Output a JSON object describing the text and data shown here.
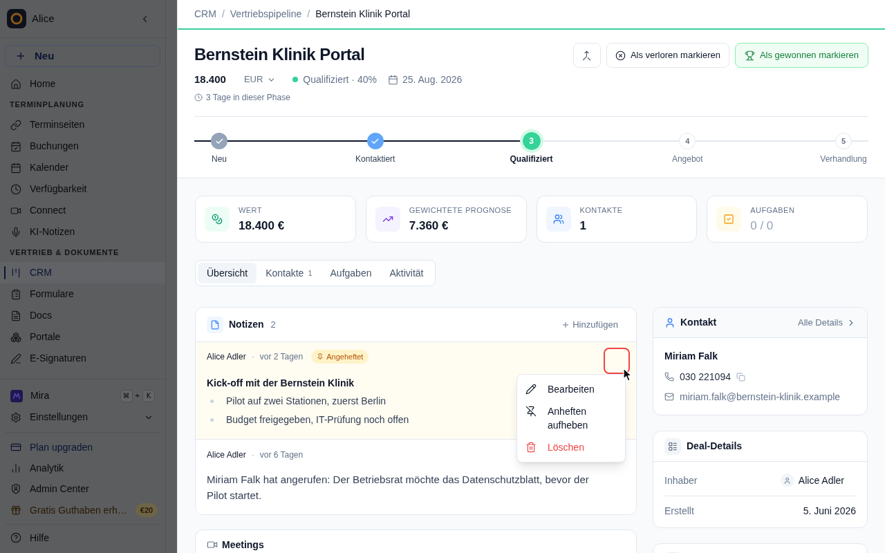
{
  "sidebar": {
    "workspace": "Alice",
    "new_button": "Neu",
    "nav": [
      {
        "kind": "item",
        "label": "Home",
        "selected": false
      },
      {
        "kind": "section",
        "label": "TERMINPLANUNG"
      },
      {
        "kind": "item",
        "label": "Terminseiten",
        "selected": false
      },
      {
        "kind": "item",
        "label": "Buchungen",
        "selected": false
      },
      {
        "kind": "item",
        "label": "Kalender",
        "selected": false
      },
      {
        "kind": "item",
        "label": "Verfügbarkeit",
        "selected": false
      },
      {
        "kind": "item",
        "label": "Connect",
        "selected": false
      },
      {
        "kind": "item",
        "label": "KI-Notizen",
        "selected": false
      },
      {
        "kind": "section",
        "label": "VERTRIEB & DOKUMENTE"
      },
      {
        "kind": "item",
        "label": "CRM",
        "selected": true
      },
      {
        "kind": "item",
        "label": "Formulare",
        "selected": false
      },
      {
        "kind": "item",
        "label": "Docs",
        "selected": false
      },
      {
        "kind": "item",
        "label": "Portale",
        "selected": false
      },
      {
        "kind": "item",
        "label": "E-Signaturen",
        "selected": false
      }
    ],
    "footer": [
      [
        {
          "kind": "assistant",
          "label": "Mira",
          "shortcut": [
            {
              "kind": "key",
              "label": "⌘"
            },
            {
              "kind": "plus",
              "label": "+"
            },
            {
              "kind": "key",
              "label": "K"
            }
          ]
        },
        {
          "kind": "expandable",
          "label": "Einstellungen",
          "expanded": false
        }
      ],
      [
        {
          "kind": "upgrade",
          "label": "Plan upgraden"
        },
        {
          "kind": "item",
          "label": "Analytik"
        },
        {
          "kind": "item",
          "label": "Admin Center"
        },
        {
          "kind": "promo",
          "label": "Gratis Guthaben erh…",
          "badge": "€20"
        }
      ],
      [
        {
          "kind": "item",
          "label": "Hilfe"
        }
      ]
    ]
  },
  "breadcrumb": [
    {
      "kind": "link",
      "label": "CRM"
    },
    {
      "kind": "separator",
      "label": "/"
    },
    {
      "kind": "link",
      "label": "Vertriebspipeline"
    },
    {
      "kind": "separator",
      "label": "/"
    },
    {
      "kind": "current",
      "label": "Bernstein Klinik Portal"
    }
  ],
  "deal": {
    "title": "Bernstein Klinik Portal",
    "amount": "18.400",
    "currency": "EUR",
    "stage": "Qualifiziert · 40%",
    "close_date": "25. Aug. 2026",
    "phase_time": "3 Tage in dieser Phase",
    "actions": [
      {
        "kind": "lost",
        "label": "Als verloren markieren"
      },
      {
        "kind": "won",
        "label": "Als gewonnen markieren"
      }
    ]
  },
  "pipeline": {
    "level": 0.5,
    "steps": [
      {
        "label": "Neu",
        "completed": true,
        "current": false,
        "color": "#94a3b8"
      },
      {
        "label": "Kontaktiert",
        "completed": true,
        "current": false,
        "color": "#60a5fa"
      },
      {
        "label": "Qualifiziert",
        "number": "3",
        "completed": false,
        "current": true,
        "color": "#34d399"
      },
      {
        "label": "Angebot",
        "number": "4",
        "completed": false,
        "current": false
      },
      {
        "label": "Verhandlung",
        "number": "5",
        "completed": false,
        "current": false
      }
    ]
  },
  "stats": [
    {
      "label": "WERT",
      "value": "18.400 €",
      "muted": false
    },
    {
      "label": "GEWICHTETE PROGNOSE",
      "value": "7.360 €",
      "muted": false
    },
    {
      "label": "KONTAKTE",
      "value": "1",
      "muted": false
    },
    {
      "label": "AUFGABEN",
      "value": "0 / 0",
      "muted": true
    }
  ],
  "tabs": [
    {
      "label": "Übersicht",
      "selected": true
    },
    {
      "label": "Kontakte",
      "count": "1",
      "selected": false
    },
    {
      "label": "Aufgaben",
      "selected": false
    },
    {
      "label": "Aktivität",
      "selected": false
    }
  ],
  "notes": {
    "title": "Notizen",
    "count": "2",
    "add": "Hinzufügen",
    "items": [
      {
        "author": "Alice Adler",
        "separator": "·",
        "time": "vor 2 Tagen",
        "pinned": true,
        "badge": "Angeheftet",
        "menu_open": true,
        "title": "Kick-off mit der Bernstein Klinik",
        "bullets": [
          "Pilot auf zwei Stationen, zuerst Berlin",
          "Budget freigegeben, IT-Prüfung noch offen"
        ]
      },
      {
        "author": "Alice Adler",
        "separator": "·",
        "time": "vor 6 Tagen",
        "pinned": false,
        "menu_open": false,
        "text": "Miriam Falk hat angerufen: Der Betriebsrat möchte das Datenschutzblatt, bevor der Pilot startet."
      }
    ],
    "menu": [
      {
        "kind": "edit",
        "label": "Bearbeiten"
      },
      {
        "kind": "unpin",
        "label": "Anheften aufheben"
      },
      {
        "kind": "delete",
        "label": "Löschen"
      }
    ]
  },
  "meetings": {
    "title": "Meetings"
  },
  "contact": {
    "title": "Kontakt",
    "link": "Alle Details",
    "name": "Miriam Falk",
    "phone": "030 221094",
    "email": "miriam.falk@bernstein-klinik.example"
  },
  "deal_details": {
    "title": "Deal-Details",
    "rows": [
      {
        "kind": "person",
        "label": "Inhaber",
        "value": "Alice Adler"
      },
      {
        "kind": "text",
        "label": "Erstellt",
        "value": "5. Juni 2026"
      }
    ]
  }
}
